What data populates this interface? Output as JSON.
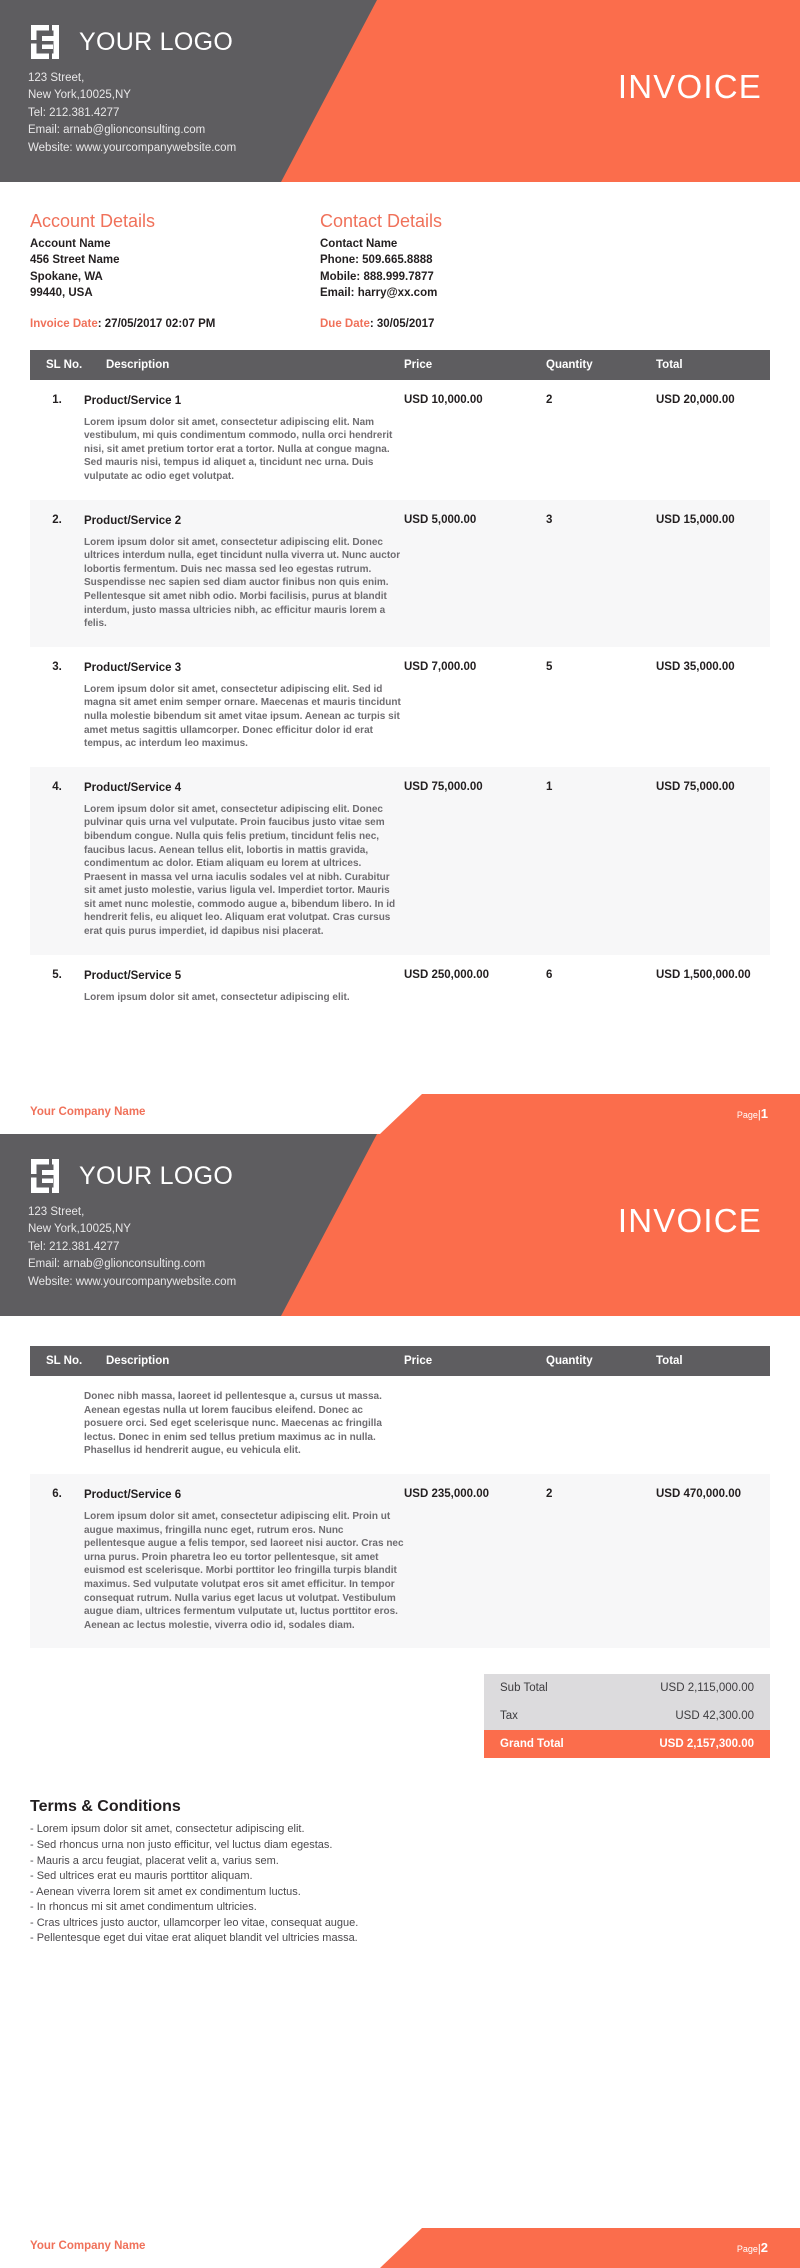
{
  "brand": {
    "orange": "#fb6d4c",
    "dark_gray": "#5e5d60",
    "light_gray": "#dcdbdd",
    "accent_text": "#f0715a"
  },
  "header": {
    "logo_text": "YOUR LOGO",
    "logo_icon": "brackets-logo-icon",
    "invoice_title": "INVOICE",
    "address_line_1": "123 Street,",
    "address_line_2": "New York,10025,NY",
    "tel": "Tel: 212.381.4277",
    "email": "Email: arnab@glionconsulting.com",
    "website": "Website: www.yourcompanywebsite.com"
  },
  "account_details": {
    "heading": "Account Details",
    "name": "Account Name",
    "street": "456 Street Name",
    "city": "Spokane, WA",
    "zip_country": "99440, USA"
  },
  "contact_details": {
    "heading": "Contact Details",
    "name": "Contact Name",
    "phone": "Phone: 509.665.8888",
    "mobile": "Mobile: 888.999.7877",
    "email": "Email: harry@xx.com"
  },
  "dates": {
    "invoice_date_label": "Invoice Date",
    "invoice_date_value": ": 27/05/2017 02:07 PM",
    "due_date_label": "Due Date",
    "due_date_value": ": 30/05/2017"
  },
  "table": {
    "columns": {
      "sl": "SL No.",
      "description": "Description",
      "price": "Price",
      "quantity": "Quantity",
      "total": "Total"
    },
    "rows_page1": [
      {
        "sl": "1.",
        "title": "Product/Service 1",
        "desc": "Lorem ipsum dolor sit amet, consectetur adipiscing elit. Nam vestibulum, mi quis condimentum commodo, nulla orci hendrerit nisi, sit amet pretium tortor erat a tortor. Nulla at congue magna. Sed mauris nisi, tempus id aliquet a, tincidunt nec urna. Duis vulputate ac odio eget volutpat.",
        "price": "USD 10,000.00",
        "qty": "2",
        "total": "USD 20,000.00"
      },
      {
        "sl": "2.",
        "title": "Product/Service 2",
        "desc": "Lorem ipsum dolor sit amet, consectetur adipiscing elit. Donec ultrices interdum nulla, eget tincidunt nulla viverra ut. Nunc auctor lobortis fermentum. Duis nec massa sed leo egestas rutrum. Suspendisse nec sapien sed diam auctor finibus non quis enim. Pellentesque sit amet nibh odio. Morbi facilisis, purus at blandit interdum, justo massa ultricies nibh, ac efficitur mauris lorem a felis.",
        "price": "USD 5,000.00",
        "qty": "3",
        "total": "USD 15,000.00"
      },
      {
        "sl": "3.",
        "title": "Product/Service 3",
        "desc": "Lorem ipsum dolor sit amet, consectetur adipiscing elit. Sed id magna sit amet enim semper ornare. Maecenas et mauris tincidunt nulla molestie bibendum sit amet vitae ipsum. Aenean ac turpis sit amet metus sagittis ullamcorper. Donec efficitur dolor id erat tempus, ac interdum leo maximus.",
        "price": "USD 7,000.00",
        "qty": "5",
        "total": "USD 35,000.00"
      },
      {
        "sl": "4.",
        "title": "Product/Service 4",
        "desc": "Lorem ipsum dolor sit amet, consectetur adipiscing elit. Donec pulvinar quis urna vel vulputate. Proin faucibus justo vitae sem bibendum congue. Nulla quis felis pretium, tincidunt felis nec, faucibus lacus. Aenean tellus elit, lobortis in mattis gravida, condimentum ac dolor. Etiam aliquam eu lorem at ultrices. Praesent in massa vel urna iaculis sodales vel at nibh. Curabitur sit amet justo molestie, varius ligula vel. Imperdiet tortor. Mauris sit amet nunc molestie, commodo augue a, bibendum libero. In id hendrerit felis, eu aliquet leo. Aliquam erat volutpat. Cras cursus erat quis purus imperdiet, id dapibus nisi placerat.",
        "price": "USD 75,000.00",
        "qty": "1",
        "total": "USD 75,000.00"
      },
      {
        "sl": "5.",
        "title": "Product/Service 5",
        "desc": "Lorem ipsum dolor sit amet, consectetur adipiscing elit.",
        "price": "USD 250,000.00",
        "qty": "6",
        "total": "USD 1,500,000.00"
      }
    ],
    "rows_page2": [
      {
        "sl": "",
        "title": "",
        "desc": "Donec nibh massa, laoreet id pellentesque a, cursus ut massa. Aenean egestas nulla ut lorem faucibus eleifend. Donec ac posuere orci. Sed eget scelerisque nunc. Maecenas ac fringilla lectus. Donec in enim sed tellus pretium maximus ac in nulla. Phasellus id hendrerit augue, eu vehicula elit.",
        "price": "",
        "qty": "",
        "total": ""
      },
      {
        "sl": "6.",
        "title": "Product/Service 6",
        "desc": "Lorem ipsum dolor sit amet, consectetur adipiscing elit. Proin ut augue maximus, fringilla nunc eget, rutrum eros. Nunc pellentesque augue a felis tempor, sed laoreet nisi auctor. Cras nec urna purus. Proin pharetra leo eu tortor pellentesque, sit amet euismod est scelerisque. Morbi porttitor leo fringilla turpis blandit maximus. Sed vulputate volutpat eros sit amet efficitur. In tempor consequat rutrum. Nulla varius eget lacus ut volutpat. Vestibulum augue diam, ultrices fermentum vulputate ut, luctus porttitor eros. Aenean ac lectus molestie, viverra odio id, sodales diam.",
        "price": "USD 235,000.00",
        "qty": "2",
        "total": "USD 470,000.00"
      }
    ]
  },
  "summary": {
    "sub_total_label": "Sub Total",
    "sub_total_value": "USD 2,115,000.00",
    "tax_label": "Tax",
    "tax_value": "USD 42,300.00",
    "grand_total_label": "Grand Total",
    "grand_total_value": "USD 2,157,300.00"
  },
  "terms": {
    "heading": "Terms & Conditions",
    "items": [
      "- Lorem ipsum dolor sit amet, consectetur adipiscing elit.",
      "- Sed rhoncus urna non justo efficitur, vel luctus diam egestas.",
      "- Mauris a arcu feugiat, placerat velit a, varius sem.",
      "- Sed ultrices erat eu mauris porttitor aliquam.",
      "- Aenean viverra lorem sit amet ex condimentum luctus.",
      "- In rhoncus mi sit amet condimentum ultricies.",
      "- Cras ultrices justo auctor, ullamcorper leo vitae, consequat augue.",
      "- Pellentesque eget dui vitae erat aliquet blandit vel ultricies massa."
    ]
  },
  "footer": {
    "company": "Your Company Name",
    "page_word": "Page",
    "separator": "|",
    "page1_number": "1",
    "page2_number": "2"
  }
}
